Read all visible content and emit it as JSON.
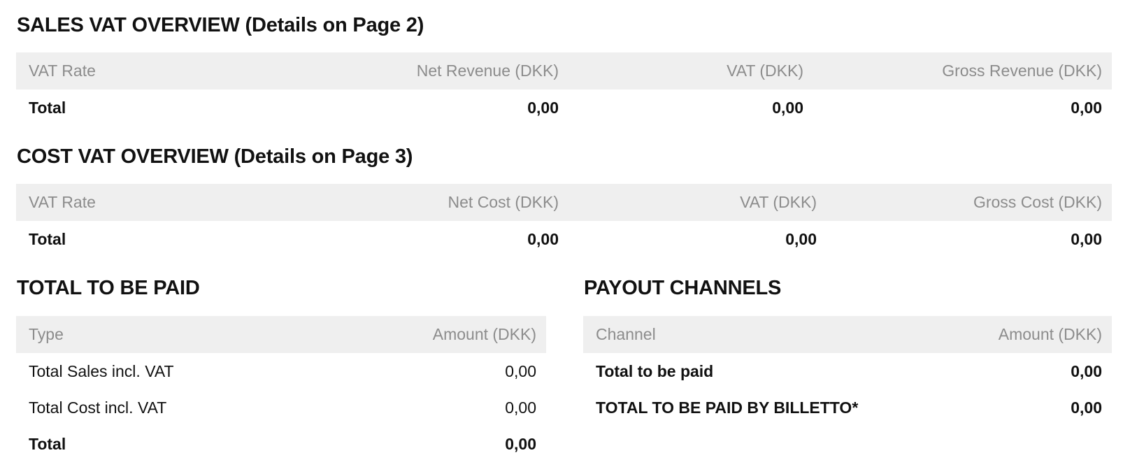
{
  "sales_vat": {
    "title": "SALES VAT OVERVIEW (Details on Page 2)",
    "headers": [
      "VAT Rate",
      "Net Revenue (DKK)",
      "VAT (DKK)",
      "Gross Revenue (DKK)"
    ],
    "total_row": [
      "Total",
      "0,00",
      "0,00",
      "0,00"
    ]
  },
  "cost_vat": {
    "title": "COST VAT OVERVIEW (Details on Page 3)",
    "headers": [
      "VAT Rate",
      "Net Cost (DKK)",
      "VAT (DKK)",
      "Gross Cost (DKK)"
    ],
    "total_row": [
      "Total",
      "0,00",
      "0,00",
      "0,00"
    ]
  },
  "total_to_be_paid": {
    "title": "TOTAL TO BE PAID",
    "headers": [
      "Type",
      "Amount (DKK)"
    ],
    "rows": [
      [
        "Total Sales incl. VAT",
        "0,00"
      ],
      [
        "Total Cost incl. VAT",
        "0,00"
      ],
      [
        "Total",
        "0,00"
      ]
    ]
  },
  "payout_channels": {
    "title": "PAYOUT CHANNELS",
    "headers": [
      "Channel",
      "Amount (DKK)"
    ],
    "rows": [
      [
        "Total to be paid",
        "0,00"
      ],
      [
        "TOTAL TO BE PAID BY BILLETTO*",
        "0,00"
      ]
    ]
  }
}
